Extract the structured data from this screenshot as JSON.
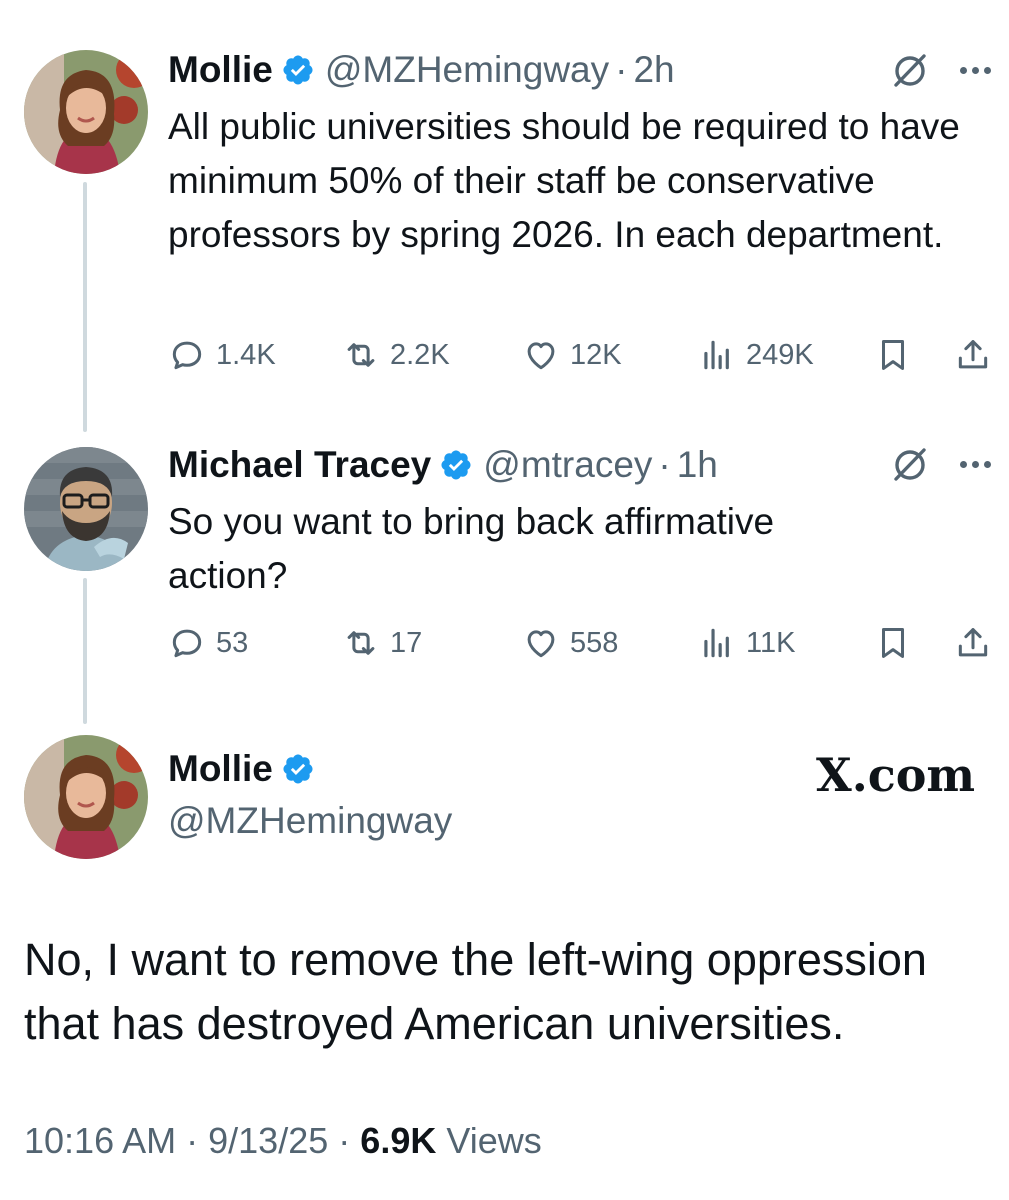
{
  "tweets": [
    {
      "name": "Mollie",
      "handle": "@MZHemingway",
      "separator": "·",
      "time": "2h",
      "text": "All public universities should be required to have minimum 50% of their staff be conservative professors by spring 2026. In each department.",
      "stats": {
        "replies": "1.4K",
        "reposts": "2.2K",
        "likes": "12K",
        "views": "249K"
      }
    },
    {
      "name": "Michael Tracey",
      "handle": "@mtracey",
      "separator": "·",
      "time": "1h",
      "text": "So you want to bring back affirmative action?",
      "stats": {
        "replies": "53",
        "reposts": "17",
        "likes": "558",
        "views": "11K"
      }
    }
  ],
  "main_tweet": {
    "name": "Mollie",
    "handle": "@MZHemingway",
    "brand": "X.com",
    "text": "No, I want to remove the left-wing oppression that has destroyed American universities.",
    "time": "10:16 AM",
    "date": "9/13/25",
    "separator": "·",
    "views_count": "6.9K",
    "views_label": "Views"
  },
  "colors": {
    "text": "#0f1419",
    "muted": "#536471",
    "verified": "#1d9bf0",
    "thread_line": "#cfd9de"
  },
  "icons": [
    "verified-badge-icon",
    "grok-icon",
    "more-icon",
    "reply-icon",
    "repost-icon",
    "like-icon",
    "views-icon",
    "bookmark-icon",
    "share-icon"
  ]
}
